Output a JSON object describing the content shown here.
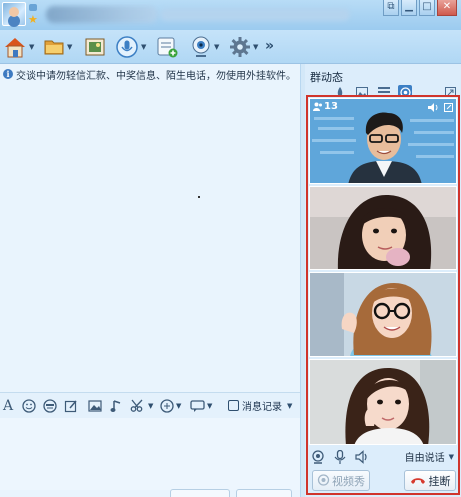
{
  "window": {
    "controls": {
      "restore": "⧉",
      "minimize": "▁",
      "maximize": "□",
      "close": "✕"
    }
  },
  "toolbar": {
    "more_label": "»",
    "icons": [
      "home-icon",
      "folder-icon",
      "picture-icon",
      "voice-icon",
      "app-icon",
      "webcam-icon",
      "gear-icon"
    ]
  },
  "chat": {
    "notice": "交谈中请勿轻信汇款、中奖信息、陌生电话，勿使用外挂软件。",
    "message_record_label": "消息记录"
  },
  "group_panel": {
    "title": "群动态",
    "tabs": [
      "paint-icon",
      "image-icon",
      "list-icon",
      "video-icon",
      "share-icon"
    ],
    "active_tab": 3,
    "video": {
      "member_count_text": "13",
      "auto_speak_label": "自由说话",
      "video_show_label": "视频秀",
      "hangup_label": "挂断",
      "hangup_color": "#d63a2e",
      "frame_color": "#d0342c"
    }
  },
  "colors": {
    "accent": "#3c7fc4",
    "titlebar": "#b8dcf6",
    "chat_bg": "#e9f4fd"
  }
}
